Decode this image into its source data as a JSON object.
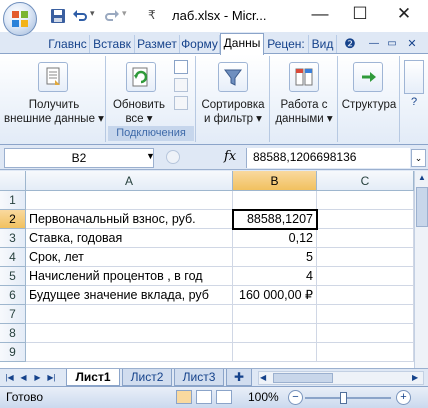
{
  "window": {
    "title": "лаб.xlsx - Micr...",
    "controls": {
      "minimize": "—",
      "maximize": "☐",
      "close": "✕"
    }
  },
  "quick_access": {
    "save": "save-icon",
    "undo": "undo-icon",
    "redo": "redo-icon",
    "customize": "₹"
  },
  "ribbon": {
    "tabs": [
      "Главнс",
      "Вставк",
      "Размет",
      "Форму",
      "Данны",
      "Рецен:",
      "Вид"
    ],
    "active_tab": "Данны",
    "groups": [
      {
        "label": "",
        "buttons": [
          {
            "line1": "Получить",
            "line2": "внешние данные ▾"
          }
        ]
      },
      {
        "label": "Подключения",
        "buttons": [
          {
            "line1": "Обновить",
            "line2": "все ▾"
          }
        ]
      },
      {
        "label": "",
        "buttons": [
          {
            "line1": "Сортировка",
            "line2": "и фильтр ▾"
          }
        ]
      },
      {
        "label": "",
        "buttons": [
          {
            "line1": "Работа с",
            "line2": "данными ▾"
          }
        ]
      },
      {
        "label": "",
        "buttons": [
          {
            "line1": "Структура",
            "line2": ""
          }
        ]
      }
    ]
  },
  "formula_bar": {
    "name_box": "B2",
    "fx": "fx",
    "formula": "88588,1206698136"
  },
  "sheet": {
    "columns": [
      "A",
      "B",
      "C"
    ],
    "selected_column": "B",
    "selected_row": "2",
    "rows": [
      {
        "num": "1",
        "a": "",
        "b": ""
      },
      {
        "num": "2",
        "a": "Первоначальный взнос, руб.",
        "b": "88588,1207"
      },
      {
        "num": "3",
        "a": "Ставка, годовая",
        "b": "0,12"
      },
      {
        "num": "4",
        "a": "Срок, лет",
        "b": "5"
      },
      {
        "num": "5",
        "a": "Начислений процентов , в год",
        "b": "4"
      },
      {
        "num": "6",
        "a": "Будущее значение вклада, руб",
        "b": "160 000,00 ₽"
      },
      {
        "num": "7",
        "a": "",
        "b": ""
      },
      {
        "num": "8",
        "a": "",
        "b": ""
      },
      {
        "num": "9",
        "a": "",
        "b": ""
      }
    ]
  },
  "sheet_tabs": [
    "Лист1",
    "Лист2",
    "Лист3"
  ],
  "active_sheet": "Лист1",
  "status_bar": {
    "ready": "Готово",
    "zoom": "100%",
    "zoom_out": "−",
    "zoom_in": "+"
  }
}
